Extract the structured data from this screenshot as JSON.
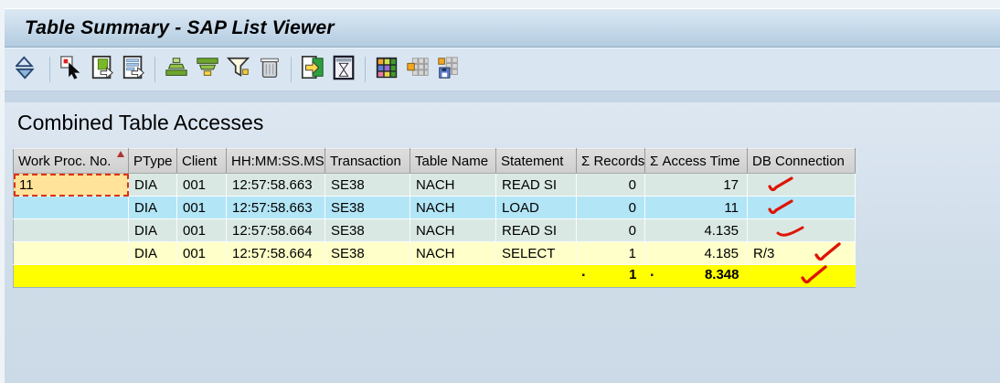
{
  "window": {
    "title": "Table Summary - SAP List Viewer"
  },
  "toolbar": {
    "groups": [
      [
        "sort-triangles-icon"
      ],
      [
        "choose-detail-icon",
        "display-document-icon",
        "display-list-icon"
      ],
      [
        "sort-ascending-icon",
        "sort-descending-icon",
        "filter-icon",
        "delete-icon"
      ],
      [
        "export-icon",
        "refresh-interval-icon"
      ],
      [
        "choose-layout-icon",
        "change-layout-icon",
        "save-layout-icon"
      ]
    ]
  },
  "content": {
    "heading": "Combined Table Accesses",
    "table": {
      "columns": [
        {
          "label": "Work Proc. No.",
          "sorted": "asc"
        },
        {
          "label": "PType"
        },
        {
          "label": "Client"
        },
        {
          "label": "HH:MM:SS.MS"
        },
        {
          "label": "Transaction"
        },
        {
          "label": "Table Name"
        },
        {
          "label": "Statement"
        },
        {
          "label": "Σ Records",
          "numeric": true
        },
        {
          "label": "Σ Access Time",
          "numeric": true
        },
        {
          "label": "DB Connection"
        }
      ],
      "rows": [
        {
          "cells": [
            "11",
            "DIA",
            "001",
            "12:57:58.663",
            "SE38",
            "NACH",
            "READ SI",
            "0",
            "17",
            ""
          ],
          "tone": "green",
          "selected_cell": 0,
          "annotation": "checkmark"
        },
        {
          "cells": [
            "",
            "DIA",
            "001",
            "12:57:58.663",
            "SE38",
            "NACH",
            "LOAD",
            "0",
            "11",
            ""
          ],
          "tone": "cyan",
          "annotation": "checkmark"
        },
        {
          "cells": [
            "",
            "DIA",
            "001",
            "12:57:58.664",
            "SE38",
            "NACH",
            "READ SI",
            "0",
            "4.135",
            ""
          ],
          "tone": "green",
          "annotation": "swoosh"
        },
        {
          "cells": [
            "",
            "DIA",
            "001",
            "12:57:58.664",
            "SE38",
            "NACH",
            "SELECT",
            "1",
            "4.185",
            "R/3"
          ],
          "tone": "yellow",
          "annotation": "checkmark-large"
        }
      ],
      "total_row": {
        "marker_symbol": "▪",
        "records": "1",
        "access_time": "8.348",
        "annotation": "checkmark-large"
      }
    }
  },
  "colors": {
    "row_green": "#d9e8e3",
    "row_cyan": "#b2e5f6",
    "row_yellow": "#ffffc9",
    "total_yellow": "#ffff00",
    "selected_cell": "#ffe39b",
    "annotation_red": "#de1505",
    "header_grey": "#d6d6d6"
  }
}
